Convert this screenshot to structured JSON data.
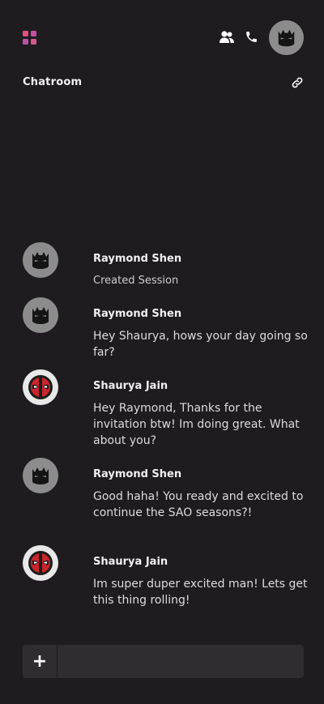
{
  "header": {
    "icons": [
      "apps-grid-icon",
      "users-icon",
      "phone-icon",
      "batman-avatar"
    ],
    "accent": "#e0507e"
  },
  "room": {
    "title": "Chatroom",
    "icon": "link-icon"
  },
  "messages": [
    {
      "author": "Raymond Shen",
      "avatar": "batman",
      "text": "Created Session",
      "kind": "system"
    },
    {
      "author": "Raymond Shen",
      "avatar": "batman",
      "text": "Hey Shaurya, hows your day going so far?"
    },
    {
      "author": "Shaurya Jain",
      "avatar": "deadpool",
      "text": "Hey Raymond, Thanks for the invitation btw! Im doing great. What about you?"
    },
    {
      "author": "Raymond Shen",
      "avatar": "batman",
      "text": "Good haha! You ready and excited to continue the SAO seasons?!"
    },
    {
      "author": "Shaurya Jain",
      "avatar": "deadpool",
      "text": "Im super duper excited man! Lets get this thing rolling!"
    }
  ],
  "composer": {
    "plus_label": "+",
    "placeholder": "",
    "value": ""
  }
}
